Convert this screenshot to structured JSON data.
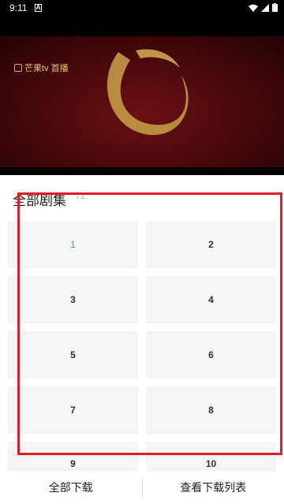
{
  "status": {
    "time": "9:11",
    "notif_letter": "A"
  },
  "video": {
    "logo_text": "芒果tv 首播"
  },
  "sheet": {
    "title": "全部剧集",
    "sort_icon_glyph": "↕z",
    "episodes": [
      "1",
      "2",
      "3",
      "4",
      "5",
      "6",
      "7",
      "8",
      "9",
      "10"
    ],
    "selected_episode": "1"
  },
  "bottom": {
    "download_all": "全部下载",
    "view_list": "查看下载列表"
  },
  "colors": {
    "accent": "#4a9be0",
    "highlight": "#e01e2a"
  }
}
